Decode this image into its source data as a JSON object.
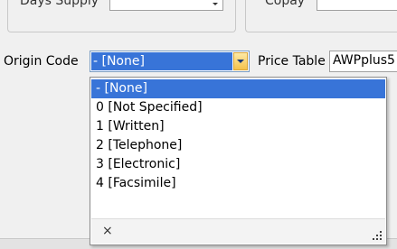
{
  "top_row": {
    "left_label": "Days Supply",
    "right_label": "Copay"
  },
  "origin": {
    "label": "Origin Code",
    "selected_value": "- [None]"
  },
  "price_table": {
    "label": "Price Table",
    "value": "AWPplus5"
  },
  "dropdown": {
    "options": [
      "- [None]",
      "0  [Not Specified]",
      "1  [Written]",
      "2  [Telephone]",
      "3  [Electronic]",
      "4  [Facsimile]"
    ],
    "selected_index": 0,
    "close_symbol": "×",
    "colors": {
      "selection": "#3874d8",
      "combo_button": "#f5c24c"
    }
  }
}
